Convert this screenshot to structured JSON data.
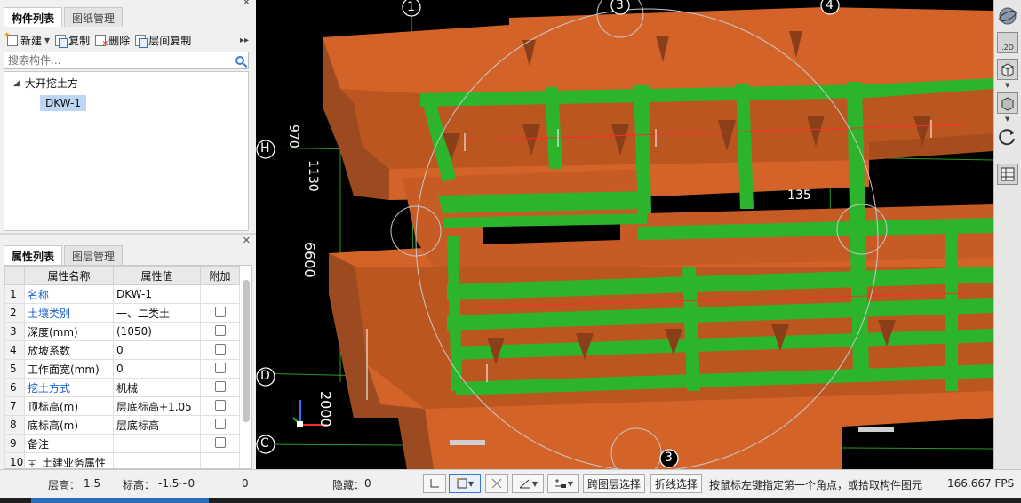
{
  "component_panel": {
    "tabs": [
      "构件列表",
      "图纸管理"
    ],
    "toolbar": {
      "new": "新建",
      "copy": "复制",
      "delete": "删除",
      "floor_copy": "层间复制"
    },
    "search_placeholder": "搜索构件...",
    "tree": {
      "root": "大开挖土方",
      "child": "DKW-1"
    }
  },
  "property_panel": {
    "tabs": [
      "属性列表",
      "图层管理"
    ],
    "columns": [
      "属性名称",
      "属性值",
      "附加"
    ],
    "rows": [
      {
        "n": "1",
        "name": "名称",
        "value": "DKW-1",
        "blue": true,
        "check": false
      },
      {
        "n": "2",
        "name": "土壤类别",
        "value": "一、二类土",
        "blue": true,
        "check": true
      },
      {
        "n": "3",
        "name": "深度(mm)",
        "value": "(1050)",
        "blue": false,
        "check": true
      },
      {
        "n": "4",
        "name": "放坡系数",
        "value": "0",
        "blue": false,
        "check": true
      },
      {
        "n": "5",
        "name": "工作面宽(mm)",
        "value": "0",
        "blue": false,
        "check": true
      },
      {
        "n": "6",
        "name": "挖土方式",
        "value": "机械",
        "blue": true,
        "check": true
      },
      {
        "n": "7",
        "name": "顶标高(m)",
        "value": "层底标高+1.05",
        "blue": false,
        "check": true
      },
      {
        "n": "8",
        "name": "底标高(m)",
        "value": "层底标高",
        "blue": false,
        "check": true
      },
      {
        "n": "9",
        "name": "备注",
        "value": "",
        "blue": false,
        "check": true
      },
      {
        "n": "10",
        "name": "土建业务属性",
        "value": "",
        "blue": false,
        "check": false
      }
    ]
  },
  "viewport": {
    "axis_numbers": [
      "1",
      "3",
      "4"
    ],
    "axis_letters": [
      "H",
      "D",
      "C"
    ],
    "dimensions": [
      "970",
      "1130",
      "6600",
      "2000",
      "135"
    ],
    "bottom_axis": "3",
    "colors": {
      "excavation": "#d4632a",
      "excavation_dark": "#9c4a1f",
      "beam": "#2cb52c",
      "background": "#000000"
    }
  },
  "status_bar": {
    "floor_height_label": "层高：",
    "floor_height": "1.5",
    "elevation_label": "标高：",
    "elevation": "-1.5~0",
    "count": "0",
    "hidden_label": "隐藏：",
    "hidden": "0",
    "cross_layer": "跨图层选择",
    "polyline": "折线选择",
    "hint": "按鼠标左键指定第一个角点，或拾取构件图元",
    "fps": "166.667 FPS"
  }
}
